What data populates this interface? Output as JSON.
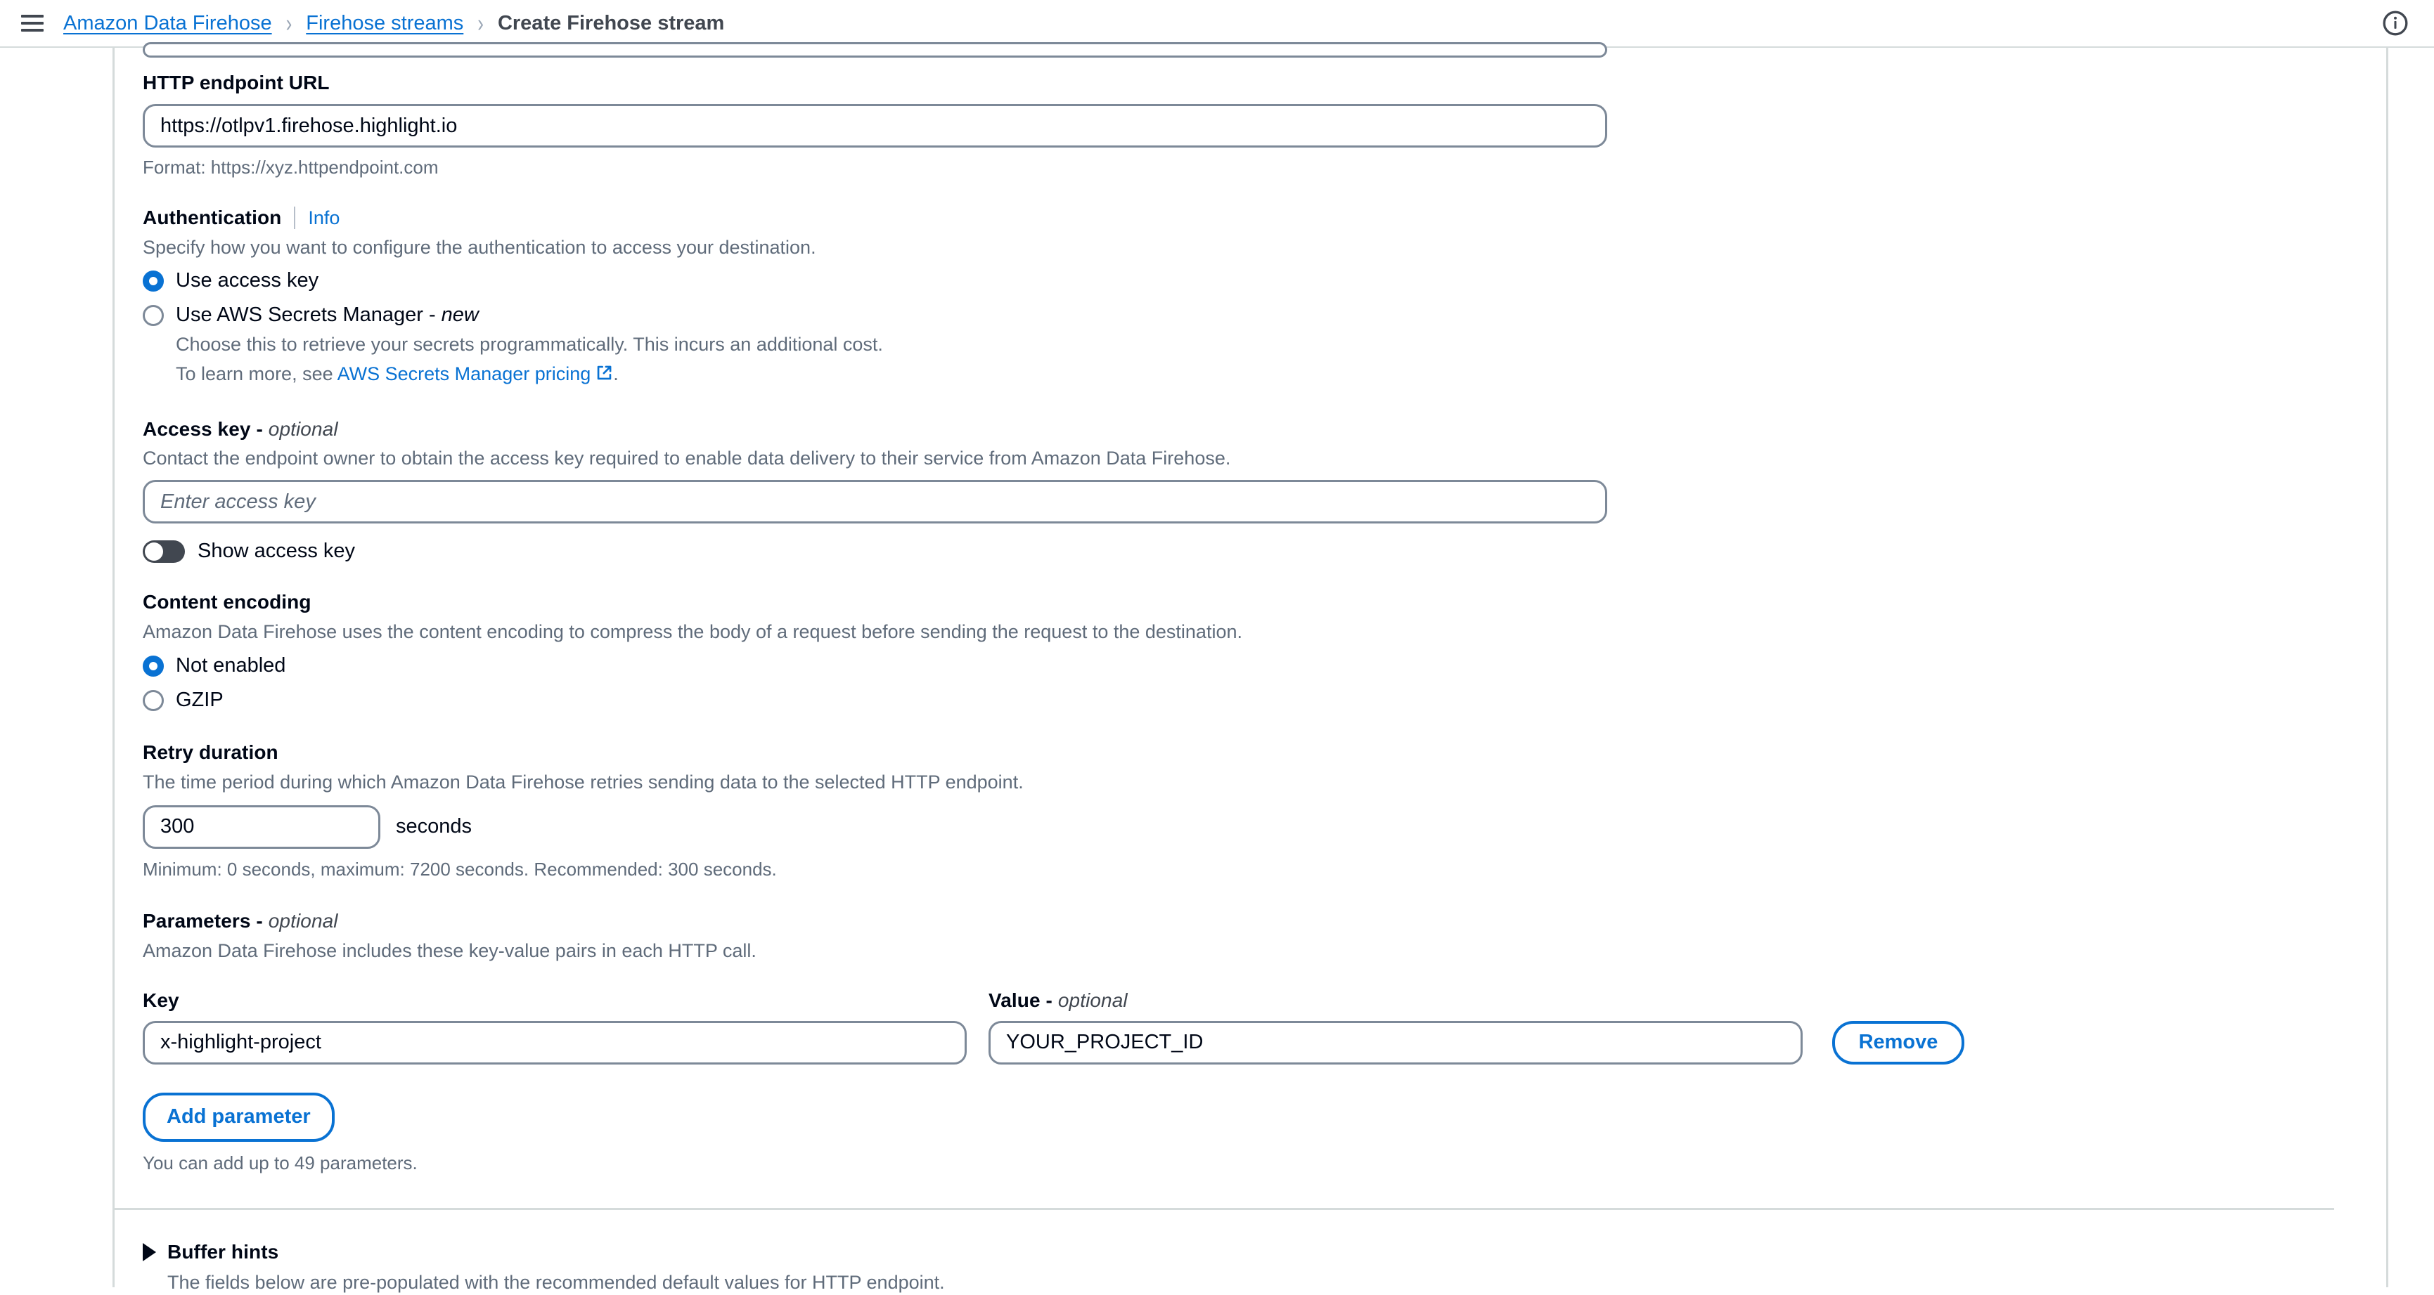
{
  "header": {
    "menu_icon": "hamburger-menu-icon",
    "info_icon": "info-circle-icon",
    "breadcrumb": [
      {
        "label": "Amazon Data Firehose",
        "current": false
      },
      {
        "label": "Firehose streams",
        "current": false
      },
      {
        "label": "Create Firehose stream",
        "current": true
      }
    ],
    "separator": "›"
  },
  "endpoint": {
    "label": "HTTP endpoint URL",
    "value": "https://otlpv1.firehose.highlight.io",
    "format_hint": "Format: https://xyz.httpendpoint.com"
  },
  "authentication": {
    "label": "Authentication",
    "info_label": "Info",
    "description": "Specify how you want to configure the authentication to access your destination.",
    "options": [
      {
        "label": "Use access key",
        "selected": true,
        "suffix": ""
      },
      {
        "label": "Use AWS Secrets Manager - ",
        "selected": false,
        "suffix": "new"
      }
    ],
    "secrets_desc": "Choose this to retrieve your secrets programmatically. This incurs an additional cost.",
    "learn_more_prefix": "To learn more, see ",
    "learn_more_link": "AWS Secrets Manager pricing",
    "learn_more_suffix": ".",
    "external_link_icon": "external-link-icon"
  },
  "access_key": {
    "label": "Access key - ",
    "label_optional": "optional",
    "description": "Contact the endpoint owner to obtain the access key required to enable data delivery to their service from Amazon Data Firehose.",
    "placeholder": "Enter access key",
    "value": "",
    "toggle_label": "Show access key",
    "toggle_on": false
  },
  "content_encoding": {
    "label": "Content encoding",
    "description": "Amazon Data Firehose uses the content encoding to compress the body of a request before sending the request to the destination.",
    "options": [
      {
        "label": "Not enabled",
        "selected": true
      },
      {
        "label": "GZIP",
        "selected": false
      }
    ]
  },
  "retry_duration": {
    "label": "Retry duration",
    "description": "The time period during which Amazon Data Firehose retries sending data to the selected HTTP endpoint.",
    "value": "300",
    "unit": "seconds",
    "hint": "Minimum: 0 seconds, maximum: 7200 seconds. Recommended: 300 seconds."
  },
  "parameters": {
    "label": "Parameters - ",
    "label_optional": "optional",
    "description": "Amazon Data Firehose includes these key-value pairs in each HTTP call.",
    "key_header": "Key",
    "value_header": "Value - ",
    "value_header_optional": "optional",
    "rows": [
      {
        "key": "x-highlight-project",
        "value": "YOUR_PROJECT_ID",
        "remove_label": "Remove"
      }
    ],
    "add_label": "Add parameter",
    "limit_hint": "You can add up to 49 parameters."
  },
  "buffer_hints": {
    "caret_icon": "caret-right-icon",
    "label": "Buffer hints",
    "description": "The fields below are pre-populated with the recommended default values for HTTP endpoint.",
    "expanded": false
  },
  "colors": {
    "link": "#0972d3",
    "text": "#000716",
    "secondary_text": "#5f6b7a",
    "border": "#7d8998",
    "divider": "#d5dbdb",
    "toggle_off": "#414750"
  }
}
